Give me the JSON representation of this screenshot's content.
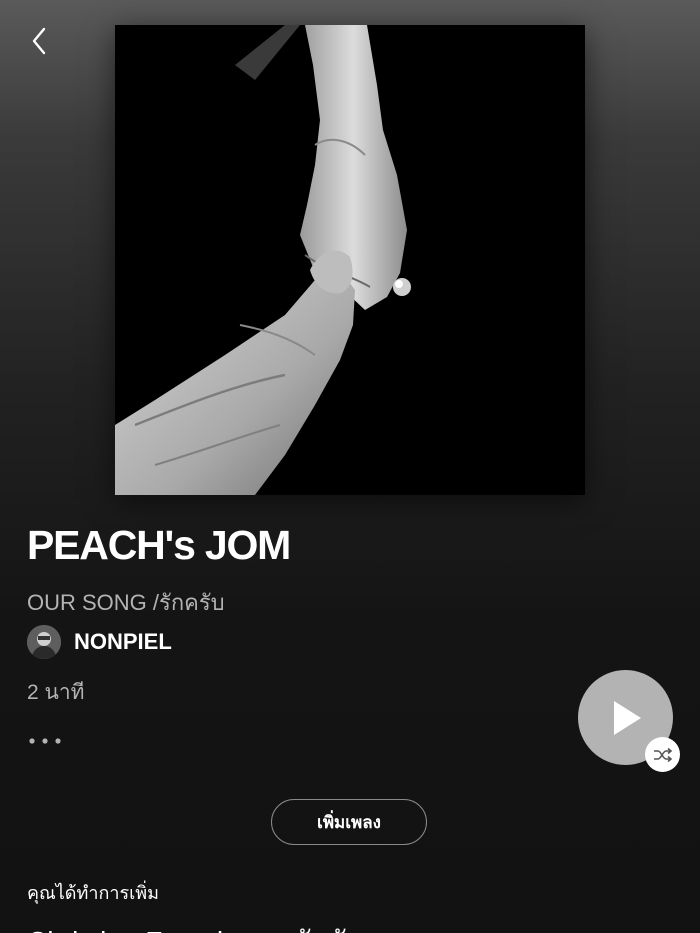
{
  "header": {
    "back_icon": "chevron-left-icon"
  },
  "playlist": {
    "title": "PEACH's JOM",
    "description": "OUR SONG /รักครับ",
    "owner_name": "NONPIEL",
    "duration": "2 นาที",
    "more_icon": "more-horizontal-icon"
  },
  "controls": {
    "play_icon": "play-icon",
    "shuffle_icon": "shuffle-icon",
    "play_button_color": "#b3b3b3"
  },
  "actions": {
    "add_song_label": "เพิ่มเพลง"
  },
  "content": {
    "you_added_label": "คุณได้ทำการเพิ่ม",
    "first_track_title": "Christian French ดูแลกับฉัน"
  },
  "colors": {
    "background": "#121212",
    "primary_text": "#ffffff",
    "secondary_text": "#b3b3b3"
  }
}
